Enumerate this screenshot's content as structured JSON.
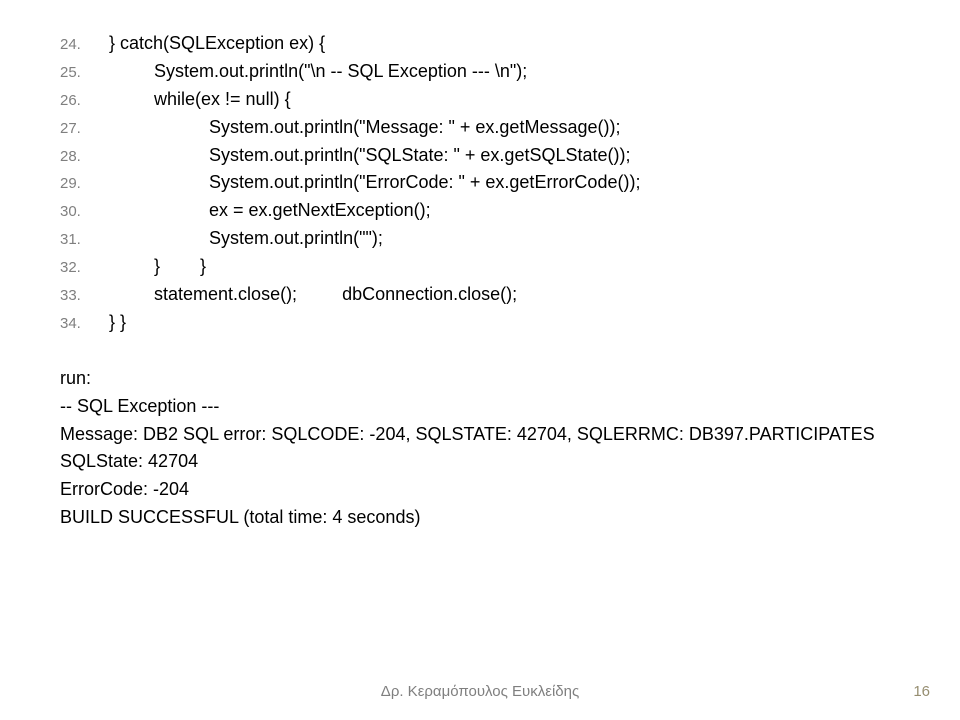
{
  "code": {
    "lines": [
      {
        "n": "24.",
        "t": "   } catch(SQLException ex) {"
      },
      {
        "n": "25.",
        "t": "            System.out.println(\"\\n -- SQL Exception --- \\n\");"
      },
      {
        "n": "26.",
        "t": "            while(ex != null) {"
      },
      {
        "n": "27.",
        "t": "                       System.out.println(\"Message: \" + ex.getMessage());"
      },
      {
        "n": "28.",
        "t": "                       System.out.println(\"SQLState: \" + ex.getSQLState());"
      },
      {
        "n": "29.",
        "t": "                       System.out.println(\"ErrorCode: \" + ex.getErrorCode());"
      },
      {
        "n": "30.",
        "t": "                       ex = ex.getNextException();"
      },
      {
        "n": "31.",
        "t": "                       System.out.println(\"\");"
      },
      {
        "n": "32.",
        "t": "            }        }"
      },
      {
        "n": "33.",
        "t": "            statement.close();         dbConnection.close();"
      },
      {
        "n": "34.",
        "t": "   } }"
      }
    ]
  },
  "output": {
    "lines": [
      "run:",
      " -- SQL Exception --- ",
      "Message: DB2 SQL error: SQLCODE: -204, SQLSTATE: 42704, SQLERRMC: DB397.PARTICIPATES",
      "SQLState: 42704",
      "ErrorCode: -204",
      "BUILD SUCCESSFUL (total time: 4 seconds)"
    ]
  },
  "footer": {
    "author": "Δρ. Κεραμόπουλος Ευκλείδης",
    "page": "16"
  }
}
